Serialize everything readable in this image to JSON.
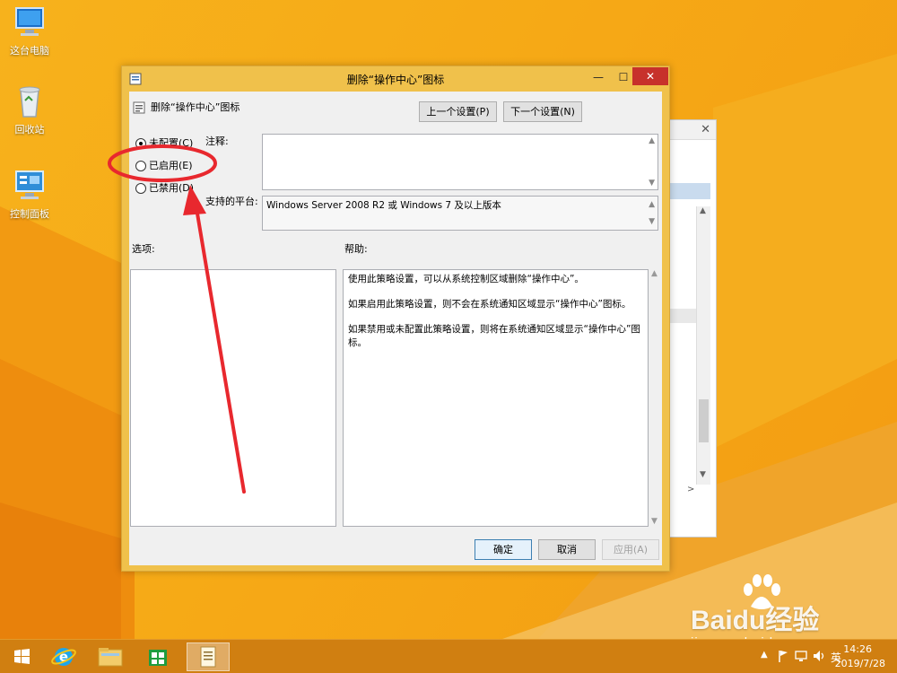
{
  "desktop": {
    "icons": [
      {
        "label": "这台电脑"
      },
      {
        "label": "回收站"
      },
      {
        "label": "控制面板"
      }
    ]
  },
  "dialog": {
    "title": "删除“操作中心”图标",
    "policy_name": "删除“操作中心”图标",
    "prev_button": "上一个设置(P)",
    "next_button": "下一个设置(N)",
    "options": [
      {
        "label": "未配置(C)",
        "selected": true
      },
      {
        "label": "已启用(E)",
        "selected": false
      },
      {
        "label": "已禁用(D)",
        "selected": false
      }
    ],
    "comment_label": "注释:",
    "comment_value": "",
    "platform_label": "支持的平台:",
    "platform_value": "Windows Server 2008 R2 或 Windows 7 及以上版本",
    "options_section_label": "选项:",
    "help_section_label": "帮助:",
    "help_paragraphs": [
      "使用此策略设置，可以从系统控制区域删除“操作中心”。",
      "如果启用此策略设置，则不会在系统通知区域显示“操作中心”图标。",
      "如果禁用或未配置此策略设置，则将在系统通知区域显示“操作中心”图标。"
    ],
    "ok_button": "确定",
    "cancel_button": "取消",
    "apply_button": "应用(A)"
  },
  "taskbar": {
    "tray": {
      "ime": "英",
      "time": "14:26",
      "date": "2019/7/28"
    }
  },
  "watermark": {
    "brand": "Baidu经验",
    "url": "jingyan.baidu.com"
  },
  "colors": {
    "desktop_accent": "#f6a916",
    "taskbar": "#d07f11",
    "annotation_red": "#e8282e",
    "close_button": "#c7312b"
  }
}
